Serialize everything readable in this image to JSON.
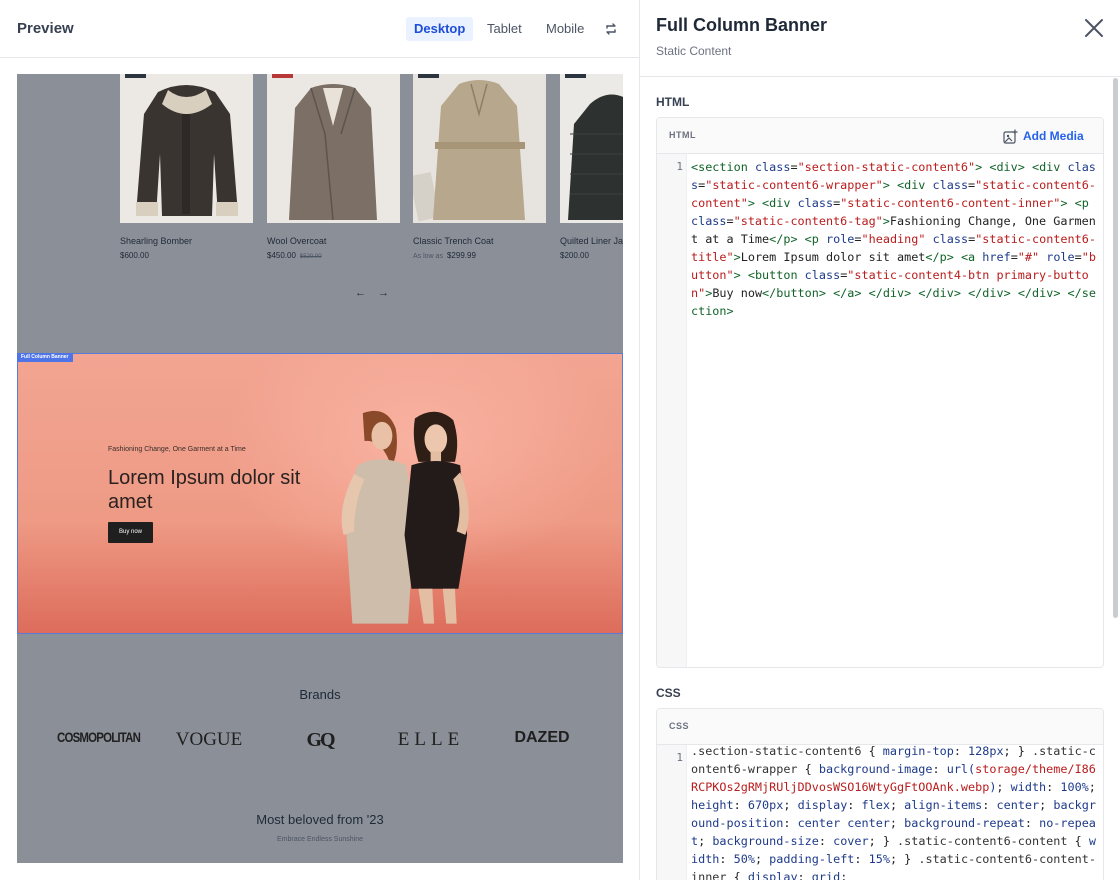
{
  "preview": {
    "title": "Preview",
    "devices": [
      "Desktop",
      "Tablet",
      "Mobile"
    ],
    "active_device": "Desktop",
    "products": [
      {
        "name": "Shearling Bomber",
        "price": "$600.00",
        "old_price": "",
        "prefix": "",
        "badge": "dark"
      },
      {
        "name": "Wool Overcoat",
        "price": "$450.00",
        "old_price": "$520.00",
        "prefix": "",
        "badge": "red"
      },
      {
        "name": "Classic Trench Coat",
        "price": "$299.99",
        "old_price": "",
        "prefix": "As low as",
        "badge": "dark"
      },
      {
        "name": "Quilted Liner Ja",
        "price": "$200.00",
        "old_price": "",
        "prefix": "",
        "badge": "dark"
      }
    ],
    "pager_prev": "←",
    "pager_next": "→",
    "banner": {
      "label": "Full Column Banner",
      "tag": "Fashioning Change, One Garment at a Time",
      "title": "Lorem Ipsum dolor sit amet",
      "button": "Buy now"
    },
    "brands_title": "Brands",
    "brands": [
      "COSMOPOLITAN",
      "VOGUE",
      "GQ",
      "ELLE",
      "DAZED"
    ],
    "beloved_title": "Most beloved from '23",
    "beloved_sub": "Embrace Endless Sunshine"
  },
  "editor": {
    "title": "Full Column Banner",
    "subtitle": "Static Content",
    "html_section": "HTML",
    "html_box_label": "HTML",
    "add_media": "Add Media",
    "css_section": "CSS",
    "css_box_label": "CSS",
    "line_number": "1"
  },
  "colors": {
    "accent": "#2563eb",
    "banner_bg": "#ef9f8a",
    "overlay": "#8b8f98",
    "selection": "#4f74e8"
  }
}
